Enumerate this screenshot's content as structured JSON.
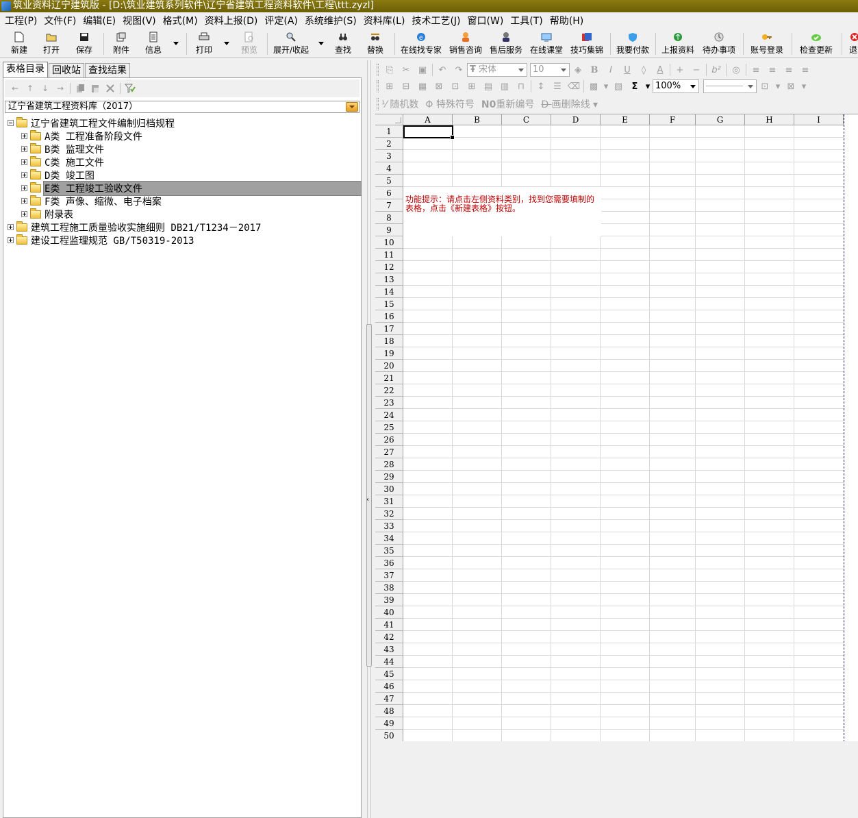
{
  "title": "筑业资料辽宁建筑版 - [D:\\筑业建筑系列软件\\辽宁省建筑工程资料软件\\工程\\ttt.zyzl]",
  "menu": [
    "工程(P)",
    "文件(F)",
    "编辑(E)",
    "视图(V)",
    "格式(M)",
    "资料上报(D)",
    "评定(A)",
    "系统维护(S)",
    "资料库(L)",
    "技术工艺(J)",
    "窗口(W)",
    "工具(T)",
    "帮助(H)"
  ],
  "toolbar": {
    "new": "新建",
    "open": "打开",
    "save": "保存",
    "attach": "附件",
    "info": "信息",
    "print": "打印",
    "preview": "预览",
    "expand": "展开/收起",
    "find": "查找",
    "replace": "替换",
    "expert": "在线找专家",
    "sales": "销售咨询",
    "service": "售后服务",
    "classroom": "在线课堂",
    "tips": "技巧集锦",
    "pay": "我要付款",
    "report": "上报资料",
    "todo": "待办事项",
    "login": "账号登录",
    "update": "检查更新",
    "exit": "退"
  },
  "left": {
    "tabs": [
      "表格目录",
      "回收站",
      "查找结果"
    ],
    "library": "辽宁省建筑工程资料库（2017）",
    "tree": [
      "辽宁省建筑工程文件编制归档规程",
      "A类 工程准备阶段文件",
      "B类 监理文件",
      "C类 施工文件",
      "D类 竣工图",
      "E类 工程竣工验收文件",
      "F类 声像、缩微、电子档案",
      "附录表",
      "建筑工程施工质量验收实施细则 DB21/T1234－2017",
      "建设工程监理规范 GB/T50319-2013"
    ]
  },
  "format": {
    "font": "宋体",
    "size": "10",
    "zoom": "100%",
    "tools": [
      "随机数",
      "特殊符号",
      "重新编号",
      "画删除线"
    ]
  },
  "sheet": {
    "columns": [
      "A",
      "B",
      "C",
      "D",
      "E",
      "F",
      "G",
      "H",
      "I"
    ],
    "rows": 50,
    "hint": "功能提示：请点击左侧资料类别，找到您需要填制的表格，点击《新建表格》按钮。"
  },
  "colors": {
    "titlebar": "#7a6c0a",
    "hint": "#c00000",
    "selection": "#a0a0a0"
  }
}
